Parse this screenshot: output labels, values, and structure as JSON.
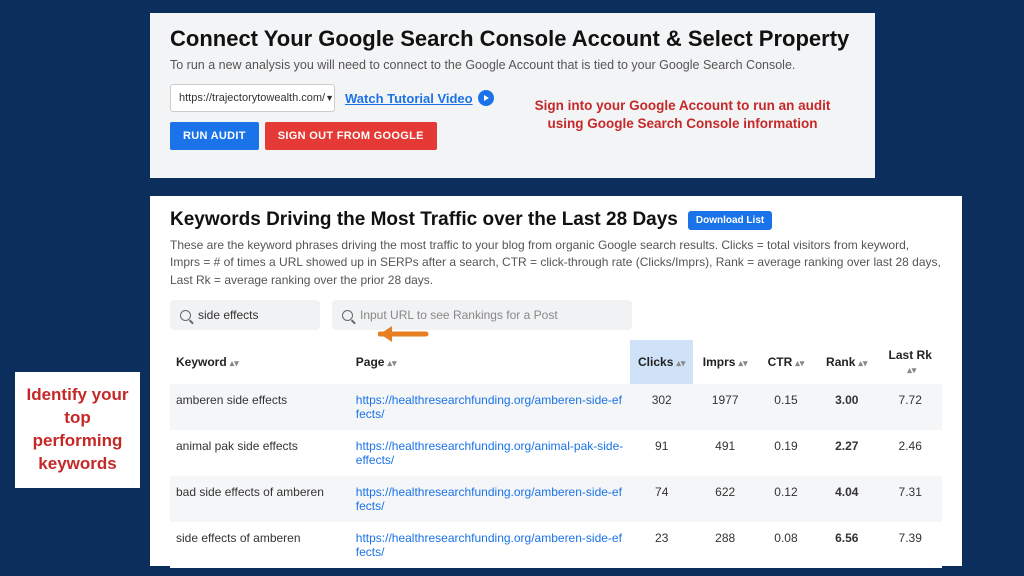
{
  "panel1": {
    "title": "Connect Your Google Search Console Account & Select Property",
    "subtitle": "To run a new analysis you will need to connect to the Google Account that is tied to your Google Search Console.",
    "property": "https://trajectorytowealth.com/",
    "tutorial_link": "Watch Tutorial Video",
    "run_audit": "RUN AUDIT",
    "sign_out": "SIGN OUT FROM GOOGLE",
    "note": "Sign into your Google Account to run an audit using Google Search Console information"
  },
  "panel2": {
    "title": "Keywords Driving the Most Traffic over the Last 28 Days",
    "download": "Download List",
    "description": "These are the keyword phrases driving the most traffic to your blog from organic Google search results. Clicks = total visitors from keyword, Imprs = # of times a URL showed up in SERPs after a search, CTR = click-through rate (Clicks/Imprs), Rank = average ranking over last 28 days, Last Rk = average ranking over the prior 28 days.",
    "search_value": "side effects",
    "url_placeholder": "Input URL to see Rankings for a Post",
    "columns": {
      "keyword": "Keyword",
      "page": "Page",
      "clicks": "Clicks",
      "imprs": "Imprs",
      "ctr": "CTR",
      "rank": "Rank",
      "lastrk": "Last Rk"
    },
    "rows": [
      {
        "keyword": "amberen side effects",
        "page": "https://healthresearchfunding.org/amberen-side-effects/",
        "clicks": "302",
        "imprs": "1977",
        "ctr": "0.15",
        "rank": "3.00",
        "lastrk": "7.72"
      },
      {
        "keyword": "animal pak side effects",
        "page": "https://healthresearchfunding.org/animal-pak-side-effects/",
        "clicks": "91",
        "imprs": "491",
        "ctr": "0.19",
        "rank": "2.27",
        "lastrk": "2.46"
      },
      {
        "keyword": "bad side effects of amberen",
        "page": "https://healthresearchfunding.org/amberen-side-effects/",
        "clicks": "74",
        "imprs": "622",
        "ctr": "0.12",
        "rank": "4.04",
        "lastrk": "7.31"
      },
      {
        "keyword": "side effects of amberen",
        "page": "https://healthresearchfunding.org/amberen-side-effects/",
        "clicks": "23",
        "imprs": "288",
        "ctr": "0.08",
        "rank": "6.56",
        "lastrk": "7.39"
      }
    ]
  },
  "callout": "Identify your top performing keywords"
}
